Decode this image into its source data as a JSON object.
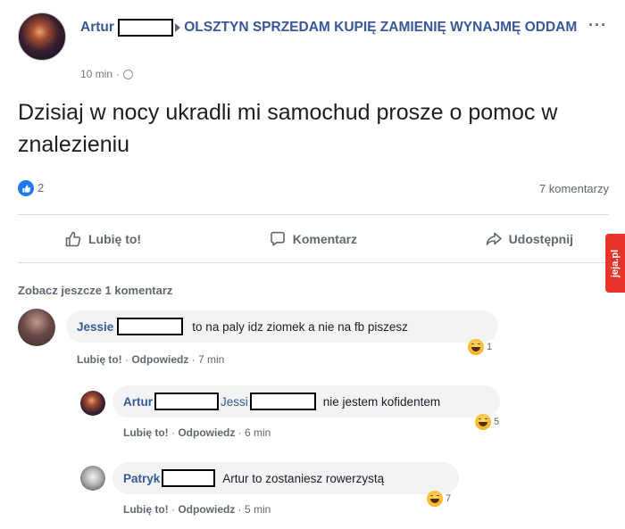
{
  "post": {
    "author": "Artur",
    "group": "OLSZTYN SPRZEDAM KUPIĘ ZAMIENIĘ WYNAJMĘ ODDAM",
    "time": "10 min",
    "more": "···",
    "text": "Dzisiaj w nocy ukradli mi samochud prosze o pomoc w znalezieniu",
    "like_count": "2",
    "comments_count": "7 komentarzy"
  },
  "actions": {
    "like": "Lubię to!",
    "comment": "Komentarz",
    "share": "Udostępnij"
  },
  "watermark": "jeja.pl",
  "see_more": "Zobacz jeszcze 1 komentarz",
  "comments": [
    {
      "name": "Jessie",
      "text": "to na paly idz ziomek a nie na fb piszesz",
      "like": "Lubię to!",
      "reply": "Odpowiedz",
      "time": "7 min",
      "reactions": "1"
    },
    {
      "name": "Artur",
      "mention": "Jessi",
      "text": "nie jestem kofidentem",
      "like": "Lubię to!",
      "reply": "Odpowiedz",
      "time": "6 min",
      "reactions": "5"
    },
    {
      "name": "Patryk",
      "text": "Artur to zostaniesz rowerzystą",
      "like": "Lubię to!",
      "reply": "Odpowiedz",
      "time": "5 min",
      "reactions": "7"
    }
  ],
  "colors": {
    "link": "#385898",
    "like_blue": "#2078f4",
    "bubble": "#f2f3f5",
    "watermark": "#e8342a"
  }
}
